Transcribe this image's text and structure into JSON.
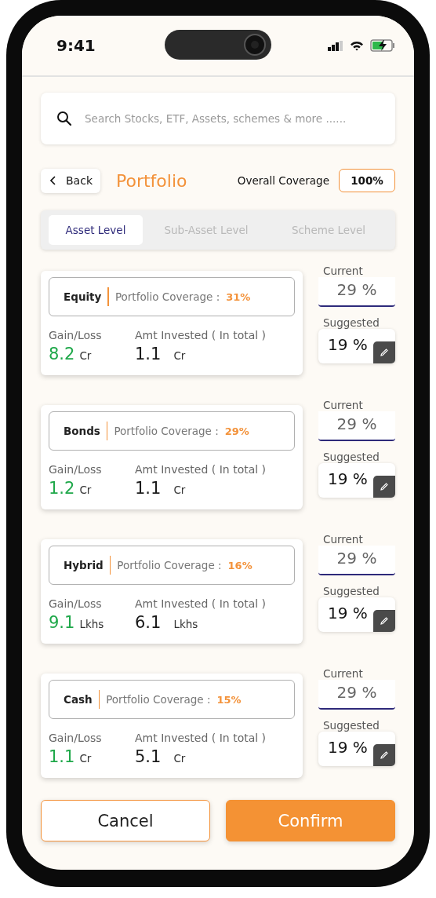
{
  "status_bar": {
    "time": "9:41"
  },
  "search": {
    "placeholder": "Search Stocks, ETF, Assets, schemes & more ......"
  },
  "header": {
    "back": "Back",
    "title": "Portfolio",
    "coverage_label": "Overall Coverage",
    "coverage_value": "100%"
  },
  "tabs": [
    {
      "label": "Asset Level",
      "selected": true
    },
    {
      "label": "Sub-Asset Level",
      "selected": false
    },
    {
      "label": "Scheme Level",
      "selected": false
    }
  ],
  "assets": [
    {
      "name": "Equity",
      "coverage_label": "Portfolio Coverage :",
      "coverage": "31%",
      "gain_label": "Gain/Loss",
      "gain": "8.2",
      "gain_unit": "Cr",
      "invested_label": "Amt Invested ( In total )",
      "invested": "1.1",
      "invested_unit": "Cr",
      "current_label": "Current",
      "current": "29 %",
      "suggested_label": "Suggested",
      "suggested": "19 %"
    },
    {
      "name": "Bonds",
      "coverage_label": "Portfolio Coverage :",
      "coverage": "29%",
      "gain_label": "Gain/Loss",
      "gain": "1.2",
      "gain_unit": "Cr",
      "invested_label": "Amt Invested ( In total )",
      "invested": "1.1",
      "invested_unit": "Cr",
      "current_label": "Current",
      "current": "29 %",
      "suggested_label": "Suggested",
      "suggested": "19 %"
    },
    {
      "name": "Hybrid",
      "coverage_label": "Portfolio Coverage :",
      "coverage": "16%",
      "gain_label": "Gain/Loss",
      "gain": "9.1",
      "gain_unit": "Lkhs",
      "invested_label": "Amt Invested ( In total )",
      "invested": "6.1",
      "invested_unit": "Lkhs",
      "current_label": "Current",
      "current": "29 %",
      "suggested_label": "Suggested",
      "suggested": "19 %"
    },
    {
      "name": "Cash",
      "coverage_label": "Portfolio Coverage :",
      "coverage": "15%",
      "gain_label": "Gain/Loss",
      "gain": "1.1",
      "gain_unit": "Cr",
      "invested_label": "Amt Invested ( In total )",
      "invested": "5.1",
      "invested_unit": "Cr",
      "current_label": "Current",
      "current": "29 %",
      "suggested_label": "Suggested",
      "suggested": "19 %"
    }
  ],
  "buttons": [
    {
      "label": "Cancel",
      "kind": "secondary"
    },
    {
      "label": "Confirm",
      "kind": "primary"
    }
  ]
}
